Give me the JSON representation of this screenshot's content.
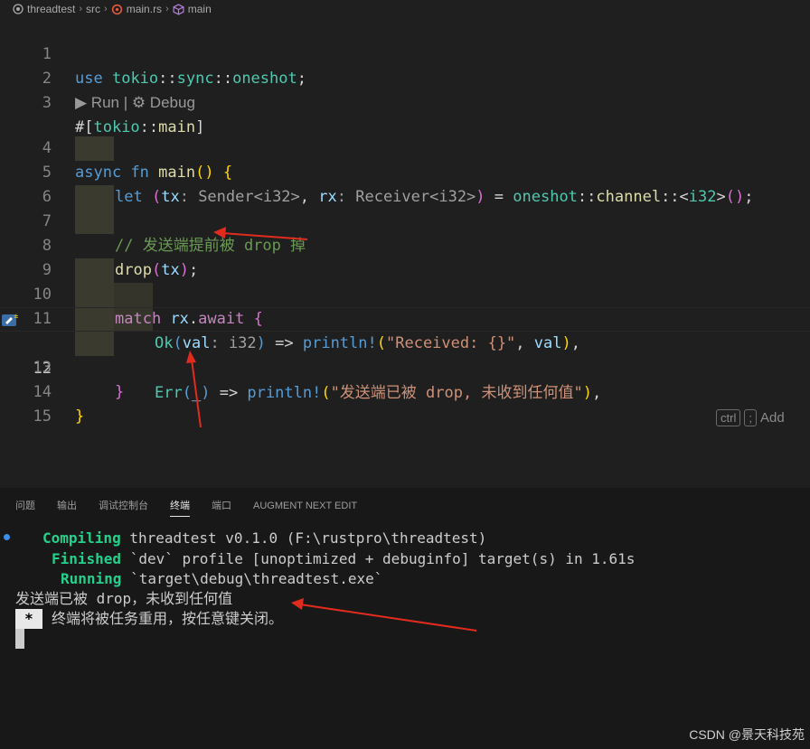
{
  "breadcrumb": {
    "items": [
      "threadtest",
      "src",
      "main.rs",
      "main"
    ]
  },
  "editor": {
    "line_numbers": [
      "1",
      "2",
      "3",
      "4",
      "5",
      "6",
      "7",
      "8",
      "9",
      "10",
      "11",
      "12",
      "13",
      "14",
      "15"
    ],
    "active_line": "12",
    "codelens": "▶ Run | ⚙ Debug",
    "ghost_hint": {
      "key1": "ctrl",
      "key2": ";",
      "text": "Add"
    },
    "lines": {
      "l1": [
        "use",
        " ",
        "tokio",
        "::",
        "sync",
        "::",
        "oneshot",
        ";"
      ],
      "l3": [
        "#[",
        "tokio",
        "::",
        "main",
        "]"
      ],
      "l4": [
        "async",
        " ",
        "fn",
        " ",
        "main",
        "()",
        " ",
        "{"
      ],
      "l5": [
        "let",
        " ",
        "(",
        "tx",
        ": ",
        "Sender<i32>",
        ", ",
        "rx",
        ": ",
        "Receiver<i32>",
        ")",
        " = ",
        "oneshot",
        "::",
        "channel",
        "::<",
        "i32",
        ">",
        "()",
        ";"
      ],
      "l7": "// 发送端提前被 drop 掉",
      "l8": [
        "drop",
        "(",
        "tx",
        ")",
        ";"
      ],
      "l10": [
        "match",
        " ",
        "rx",
        ".",
        "await",
        " ",
        "{"
      ],
      "l11": [
        "Ok",
        "(",
        "val",
        ": ",
        "i32",
        ")",
        " => ",
        "println!",
        "(",
        "\"Received: {}\"",
        ", ",
        "val",
        ")",
        ","
      ],
      "l12": [
        "Err",
        "(",
        "_",
        ")",
        " => ",
        "println!",
        "(",
        "\"发送端已被 drop, 未收到任何值\"",
        ")",
        ","
      ],
      "l13": "}",
      "l14": "}"
    }
  },
  "panel": {
    "tabs": [
      "问题",
      "输出",
      "调试控制台",
      "终端",
      "端口",
      "AUGMENT NEXT EDIT"
    ],
    "active_tab": "终端",
    "terminal": {
      "compiling_label": "Compiling",
      "compiling_text": " threadtest v0.1.0 (F:\\rustpro\\threadtest)",
      "finished_label": "Finished",
      "finished_text": " `dev` profile [unoptimized + debuginfo] target(s) in 1.61s",
      "running_label": "Running",
      "running_text": " `target\\debug\\threadtest.exe`",
      "output": "发送端已被 drop，未收到任何值",
      "star": "*",
      "reuse_msg": "终端将被任务重用，按任意键关闭。"
    }
  },
  "watermark": "CSDN @景天科技苑",
  "colors": {
    "background": "#1f1f1f",
    "arrow": "#e22b1f",
    "green": "#23d18b"
  }
}
